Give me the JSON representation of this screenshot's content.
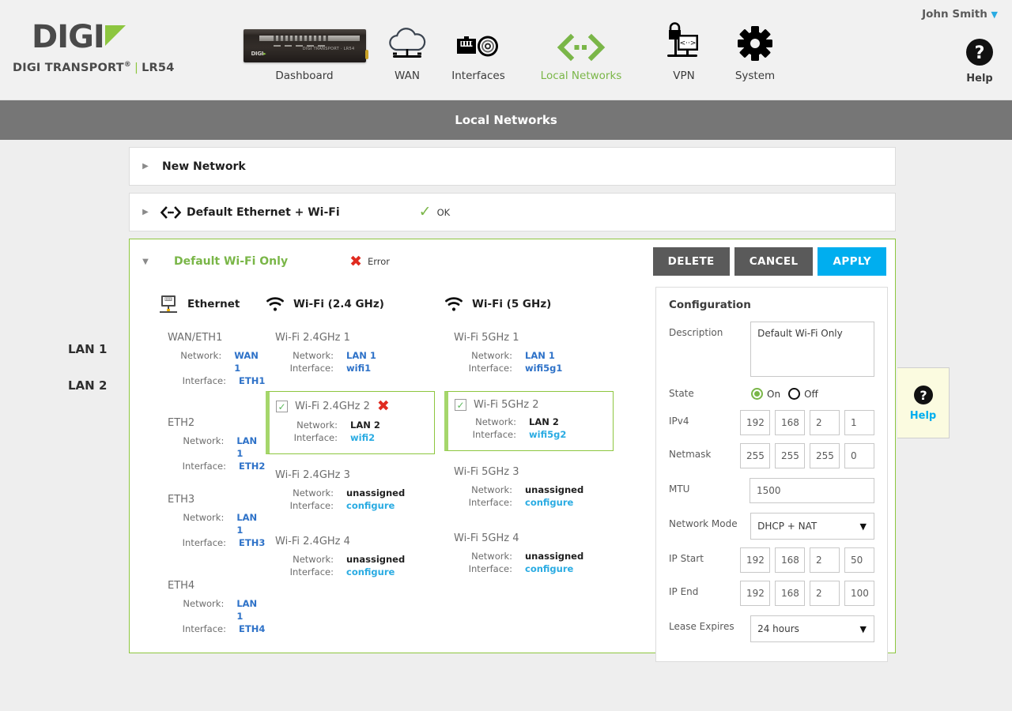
{
  "brand": {
    "logo_word": "DIGI",
    "product": "DIGI TRANSPORT",
    "reg": "®",
    "model": "LR54"
  },
  "header": {
    "user_name": "John Smith",
    "user_caret": "▼",
    "help_label": "Help",
    "help_icon": "question-circle-icon",
    "nav": [
      {
        "label": "Dashboard",
        "icon": "router-device-icon",
        "active": false
      },
      {
        "label": "WAN",
        "icon": "cloud-icon",
        "active": false
      },
      {
        "label": "Interfaces",
        "icon": "ethernet-port-icon",
        "active": false
      },
      {
        "label": "Local Networks",
        "icon": "local-networks-icon",
        "active": true
      },
      {
        "label": "VPN",
        "icon": "vpn-lock-monitor-icon",
        "active": false
      },
      {
        "label": "System",
        "icon": "gear-icon",
        "active": false
      }
    ]
  },
  "page_title": "Local Networks",
  "lan_labels": {
    "lan1": "LAN 1",
    "lan2": "LAN 2"
  },
  "rows": {
    "new_network": {
      "title": "New Network",
      "arrow": "▶"
    },
    "lan1": {
      "title": "Default Ethernet + Wi-Fi",
      "arrow": "▶",
      "icon": "local-networks-icon",
      "status_text": "OK",
      "status_icon": "check-icon"
    },
    "lan2": {
      "title": "Default Wi-Fi Only",
      "arrow": "▼",
      "status_text": "Error",
      "status_icon": "error-x-icon"
    }
  },
  "actions": {
    "delete": "DELETE",
    "cancel": "CANCEL",
    "apply": "APPLY"
  },
  "help_tab": {
    "label": "Help",
    "icon": "question-circle-icon"
  },
  "columns": {
    "ethernet": {
      "title": "Ethernet",
      "icon": "ethernet-port-icon",
      "ports": [
        {
          "name": "WAN/ETH1",
          "network_label": "Network:",
          "network": "WAN 1",
          "interface_label": "Interface:",
          "interface": "ETH1"
        },
        {
          "name": "ETH2",
          "network_label": "Network:",
          "network": "LAN 1",
          "interface_label": "Interface:",
          "interface": "ETH2"
        },
        {
          "name": "ETH3",
          "network_label": "Network:",
          "network": "LAN 1",
          "interface_label": "Interface:",
          "interface": "ETH3"
        },
        {
          "name": "ETH4",
          "network_label": "Network:",
          "network": "LAN 1",
          "interface_label": "Interface:",
          "interface": "ETH4"
        }
      ]
    },
    "wifi24": {
      "title": "Wi-Fi (2.4 GHz)",
      "icon": "wifi-icon",
      "ports": [
        {
          "name": "Wi-Fi 2.4GHz 1",
          "network_label": "Network:",
          "network": "LAN 1",
          "interface_label": "Interface:",
          "interface": "wifi1"
        },
        {
          "name": "Wi-Fi 2.4GHz 2",
          "network_label": "Network:",
          "network": "LAN 2",
          "interface_label": "Interface:",
          "interface": "wifi2",
          "selected": true,
          "status_icon": "error-x-icon"
        },
        {
          "name": "Wi-Fi 2.4GHz  3",
          "network_label": "Network:",
          "network": "unassigned",
          "interface_label": "Interface:",
          "interface": "configure"
        },
        {
          "name": "Wi-Fi 2.4GHz  4",
          "network_label": "Network:",
          "network": "unassigned",
          "interface_label": "Interface:",
          "interface": "configure"
        }
      ]
    },
    "wifi5": {
      "title": "Wi-Fi (5 GHz)",
      "icon": "wifi-icon",
      "ports": [
        {
          "name": "Wi-Fi 5GHz 1",
          "network_label": "Network:",
          "network": "LAN 1",
          "interface_label": "Interface:",
          "interface": "wifi5g1"
        },
        {
          "name": "Wi-Fi 5GHz 2",
          "network_label": "Network:",
          "network": "LAN 2",
          "interface_label": "Interface:",
          "interface": "wifi5g2",
          "selected": true
        },
        {
          "name": "Wi-Fi 5GHz  3",
          "network_label": "Network:",
          "network": "unassigned",
          "interface_label": "Interface:",
          "interface": "configure"
        },
        {
          "name": "Wi-Fi 5GHz  4",
          "network_label": "Network:",
          "network": "unassigned",
          "interface_label": "Interface:",
          "interface": "configure"
        }
      ]
    }
  },
  "configuration": {
    "title": "Configuration",
    "description_label": "Description",
    "description_value": "Default Wi-Fi Only",
    "state_label": "State",
    "state_on": "On",
    "state_off": "Off",
    "state_selected": "On",
    "ipv4_label": "IPv4",
    "ipv4": [
      "192",
      "168",
      "2",
      "1"
    ],
    "netmask_label": "Netmask",
    "netmask": [
      "255",
      "255",
      "255",
      "0"
    ],
    "mtu_label": "MTU",
    "mtu_value": "1500",
    "network_mode_label": "Network Mode",
    "network_mode_value": "DHCP + NAT",
    "ip_start_label": "IP Start",
    "ip_start": [
      "192",
      "168",
      "2",
      "50"
    ],
    "ip_end_label": "IP End",
    "ip_end": [
      "192",
      "168",
      "2",
      "100"
    ],
    "lease_label": "Lease Expires",
    "lease_value": "24 hours",
    "caret": "▼"
  },
  "colors": {
    "brand_green": "#8dc63f",
    "accent_blue": "#00aeef",
    "link_blue": "#2e72c8",
    "error_red": "#e02b20",
    "titlebar_grey": "#767676"
  }
}
